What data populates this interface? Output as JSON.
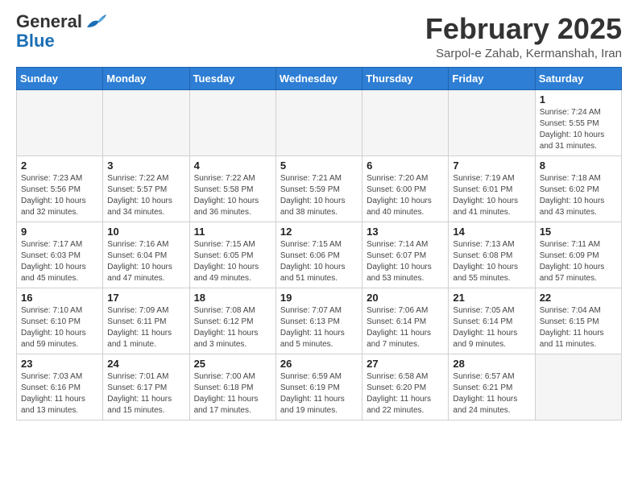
{
  "header": {
    "logo_general": "General",
    "logo_blue": "Blue",
    "month_title": "February 2025",
    "subtitle": "Sarpol-e Zahab, Kermanshah, Iran"
  },
  "weekdays": [
    "Sunday",
    "Monday",
    "Tuesday",
    "Wednesday",
    "Thursday",
    "Friday",
    "Saturday"
  ],
  "weeks": [
    [
      {
        "day": "",
        "info": ""
      },
      {
        "day": "",
        "info": ""
      },
      {
        "day": "",
        "info": ""
      },
      {
        "day": "",
        "info": ""
      },
      {
        "day": "",
        "info": ""
      },
      {
        "day": "",
        "info": ""
      },
      {
        "day": "1",
        "info": "Sunrise: 7:24 AM\nSunset: 5:55 PM\nDaylight: 10 hours\nand 31 minutes."
      }
    ],
    [
      {
        "day": "2",
        "info": "Sunrise: 7:23 AM\nSunset: 5:56 PM\nDaylight: 10 hours\nand 32 minutes."
      },
      {
        "day": "3",
        "info": "Sunrise: 7:22 AM\nSunset: 5:57 PM\nDaylight: 10 hours\nand 34 minutes."
      },
      {
        "day": "4",
        "info": "Sunrise: 7:22 AM\nSunset: 5:58 PM\nDaylight: 10 hours\nand 36 minutes."
      },
      {
        "day": "5",
        "info": "Sunrise: 7:21 AM\nSunset: 5:59 PM\nDaylight: 10 hours\nand 38 minutes."
      },
      {
        "day": "6",
        "info": "Sunrise: 7:20 AM\nSunset: 6:00 PM\nDaylight: 10 hours\nand 40 minutes."
      },
      {
        "day": "7",
        "info": "Sunrise: 7:19 AM\nSunset: 6:01 PM\nDaylight: 10 hours\nand 41 minutes."
      },
      {
        "day": "8",
        "info": "Sunrise: 7:18 AM\nSunset: 6:02 PM\nDaylight: 10 hours\nand 43 minutes."
      }
    ],
    [
      {
        "day": "9",
        "info": "Sunrise: 7:17 AM\nSunset: 6:03 PM\nDaylight: 10 hours\nand 45 minutes."
      },
      {
        "day": "10",
        "info": "Sunrise: 7:16 AM\nSunset: 6:04 PM\nDaylight: 10 hours\nand 47 minutes."
      },
      {
        "day": "11",
        "info": "Sunrise: 7:15 AM\nSunset: 6:05 PM\nDaylight: 10 hours\nand 49 minutes."
      },
      {
        "day": "12",
        "info": "Sunrise: 7:15 AM\nSunset: 6:06 PM\nDaylight: 10 hours\nand 51 minutes."
      },
      {
        "day": "13",
        "info": "Sunrise: 7:14 AM\nSunset: 6:07 PM\nDaylight: 10 hours\nand 53 minutes."
      },
      {
        "day": "14",
        "info": "Sunrise: 7:13 AM\nSunset: 6:08 PM\nDaylight: 10 hours\nand 55 minutes."
      },
      {
        "day": "15",
        "info": "Sunrise: 7:11 AM\nSunset: 6:09 PM\nDaylight: 10 hours\nand 57 minutes."
      }
    ],
    [
      {
        "day": "16",
        "info": "Sunrise: 7:10 AM\nSunset: 6:10 PM\nDaylight: 10 hours\nand 59 minutes."
      },
      {
        "day": "17",
        "info": "Sunrise: 7:09 AM\nSunset: 6:11 PM\nDaylight: 11 hours\nand 1 minute."
      },
      {
        "day": "18",
        "info": "Sunrise: 7:08 AM\nSunset: 6:12 PM\nDaylight: 11 hours\nand 3 minutes."
      },
      {
        "day": "19",
        "info": "Sunrise: 7:07 AM\nSunset: 6:13 PM\nDaylight: 11 hours\nand 5 minutes."
      },
      {
        "day": "20",
        "info": "Sunrise: 7:06 AM\nSunset: 6:14 PM\nDaylight: 11 hours\nand 7 minutes."
      },
      {
        "day": "21",
        "info": "Sunrise: 7:05 AM\nSunset: 6:14 PM\nDaylight: 11 hours\nand 9 minutes."
      },
      {
        "day": "22",
        "info": "Sunrise: 7:04 AM\nSunset: 6:15 PM\nDaylight: 11 hours\nand 11 minutes."
      }
    ],
    [
      {
        "day": "23",
        "info": "Sunrise: 7:03 AM\nSunset: 6:16 PM\nDaylight: 11 hours\nand 13 minutes."
      },
      {
        "day": "24",
        "info": "Sunrise: 7:01 AM\nSunset: 6:17 PM\nDaylight: 11 hours\nand 15 minutes."
      },
      {
        "day": "25",
        "info": "Sunrise: 7:00 AM\nSunset: 6:18 PM\nDaylight: 11 hours\nand 17 minutes."
      },
      {
        "day": "26",
        "info": "Sunrise: 6:59 AM\nSunset: 6:19 PM\nDaylight: 11 hours\nand 19 minutes."
      },
      {
        "day": "27",
        "info": "Sunrise: 6:58 AM\nSunset: 6:20 PM\nDaylight: 11 hours\nand 22 minutes."
      },
      {
        "day": "28",
        "info": "Sunrise: 6:57 AM\nSunset: 6:21 PM\nDaylight: 11 hours\nand 24 minutes."
      },
      {
        "day": "",
        "info": ""
      }
    ]
  ]
}
